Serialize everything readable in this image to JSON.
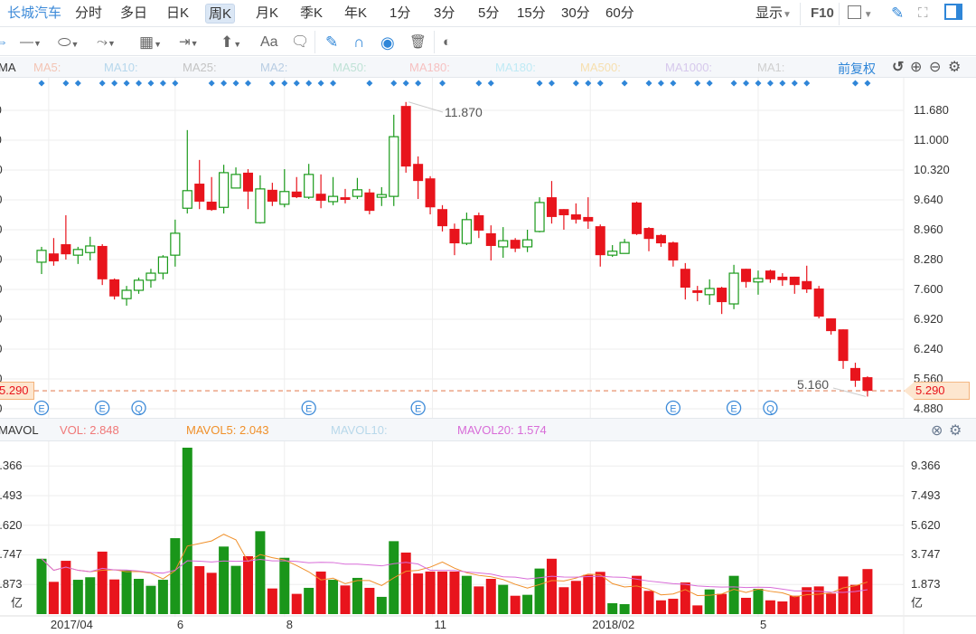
{
  "topbar": {
    "stock_name": "长城汽车",
    "periods": [
      "分时",
      "多日",
      "日K",
      "周K",
      "月K",
      "季K",
      "年K",
      "1分",
      "3分",
      "5分",
      "15分",
      "30分",
      "60分"
    ],
    "selected_period": "周K",
    "display_label": "显示",
    "f10_label": "F10"
  },
  "toolbar": {
    "tools": [
      {
        "name": "line-tool",
        "glyph": "—▾"
      },
      {
        "name": "shape-tool",
        "glyph": "⬭▾"
      },
      {
        "name": "wave-tool",
        "glyph": "⤳▾"
      },
      {
        "name": "grid-tool",
        "glyph": "▦▾"
      },
      {
        "name": "range-tool",
        "glyph": "⇥▾"
      },
      {
        "name": "arrow-tool",
        "glyph": "⬆▾"
      },
      {
        "name": "text-tool",
        "glyph": "Aa"
      },
      {
        "name": "comment-tool",
        "glyph": "▭"
      }
    ],
    "text_tool_label": "Aa"
  },
  "ma_legend": {
    "title": "MA",
    "items": [
      {
        "label": "MA5:",
        "color": "#f3c4b4"
      },
      {
        "label": "MA10:",
        "color": "#b6d7ec"
      },
      {
        "label": "MA25:",
        "color": "#c4c4c4"
      },
      {
        "label": "MA2:",
        "color": "#b8cde3"
      },
      {
        "label": "MA50:",
        "color": "#bfe2d6"
      },
      {
        "label": "MA180:",
        "color": "#f6c1c1"
      },
      {
        "label": "MA180:",
        "color": "#bfeaf5"
      },
      {
        "label": "MA500:",
        "color": "#f6dfae"
      },
      {
        "label": "MA1000:",
        "color": "#d6c8ec"
      },
      {
        "label": "MA1:",
        "color": "#cfcfcf"
      }
    ],
    "adjust_label": "前复权"
  },
  "vol_legend": {
    "title": "MAVOL",
    "vol": "VOL: 2.848",
    "mavol5": "MAVOL5: 2.043",
    "mavol10": "MAVOL10:",
    "mavol20": "MAVOL20: 1.574",
    "colors": {
      "vol": "#f07878",
      "mavol5": "#f0902a",
      "mavol10": "#b8d8ea",
      "mavol20": "#d86cd8"
    }
  },
  "colors": {
    "up": "#1a9a1a",
    "down": "#e8141c",
    "accent": "#2f86d8",
    "grid": "#eeeeee"
  },
  "chart_data": {
    "type": "candlestick",
    "price_ticks": [
      "11.680",
      "11.000",
      "10.320",
      "9.640",
      "8.960",
      "8.280",
      "7.600",
      "6.920",
      "6.240",
      "5.560",
      "4.880"
    ],
    "price_tick_values": [
      11.68,
      11.0,
      10.32,
      9.64,
      8.96,
      8.28,
      7.6,
      6.92,
      6.24,
      5.56,
      4.88
    ],
    "ylim": [
      4.88,
      11.68
    ],
    "volume_ticks": [
      "9.366",
      "7.493",
      "5.620",
      "3.747",
      "1.873"
    ],
    "volume_tick_values": [
      9.366,
      7.493,
      5.62,
      3.747,
      1.873
    ],
    "volume_unit": "亿",
    "x_labels": [
      {
        "label": "2017/04",
        "index": 2
      },
      {
        "label": "6",
        "index": 11
      },
      {
        "label": "8",
        "index": 20
      },
      {
        "label": "11",
        "index": 33
      },
      {
        "label": "2018/02",
        "index": 46
      },
      {
        "label": "5",
        "index": 59
      }
    ],
    "last_price": "5.290",
    "last_price_value": 5.29,
    "high_label": "11.870",
    "high_index": 30,
    "low_label": "5.160",
    "low_index": 68,
    "ohlc": [
      [
        8.22,
        8.57,
        7.95,
        8.49
      ],
      [
        8.42,
        8.77,
        8.14,
        8.24
      ],
      [
        8.63,
        9.29,
        8.28,
        8.4
      ],
      [
        8.38,
        8.57,
        8.18,
        8.51
      ],
      [
        8.44,
        8.8,
        8.26,
        8.59
      ],
      [
        8.59,
        8.63,
        7.7,
        7.83
      ],
      [
        7.83,
        7.85,
        7.37,
        7.44
      ],
      [
        7.39,
        7.68,
        7.23,
        7.58
      ],
      [
        7.58,
        7.87,
        7.5,
        7.81
      ],
      [
        7.81,
        8.07,
        7.64,
        7.97
      ],
      [
        7.97,
        8.38,
        7.83,
        8.34
      ],
      [
        8.38,
        9.19,
        8.12,
        8.88
      ],
      [
        9.45,
        11.23,
        9.33,
        9.85
      ],
      [
        10.01,
        10.55,
        9.43,
        9.6
      ],
      [
        9.6,
        10.16,
        9.39,
        9.41
      ],
      [
        9.47,
        10.44,
        9.33,
        10.26
      ],
      [
        9.91,
        10.38,
        9.91,
        10.22
      ],
      [
        10.26,
        10.34,
        9.43,
        9.83
      ],
      [
        9.12,
        10.2,
        9.1,
        9.89
      ],
      [
        9.87,
        10.03,
        9.5,
        9.6
      ],
      [
        9.54,
        10.34,
        9.47,
        9.83
      ],
      [
        9.83,
        10.16,
        9.68,
        9.7
      ],
      [
        9.7,
        10.46,
        9.66,
        10.22
      ],
      [
        9.78,
        10.22,
        9.45,
        9.62
      ],
      [
        9.6,
        10.16,
        9.52,
        9.72
      ],
      [
        9.7,
        9.89,
        9.56,
        9.64
      ],
      [
        9.72,
        10.14,
        9.66,
        9.87
      ],
      [
        9.81,
        9.89,
        9.31,
        9.39
      ],
      [
        9.7,
        9.93,
        9.5,
        9.76
      ],
      [
        9.72,
        11.58,
        9.5,
        11.08
      ],
      [
        11.78,
        11.87,
        10.26,
        10.4
      ],
      [
        10.46,
        10.63,
        9.66,
        10.07
      ],
      [
        10.13,
        10.18,
        9.31,
        9.47
      ],
      [
        9.43,
        9.52,
        8.92,
        9.04
      ],
      [
        8.98,
        9.1,
        8.38,
        8.65
      ],
      [
        8.65,
        9.35,
        8.61,
        9.19
      ],
      [
        9.29,
        9.35,
        8.77,
        8.94
      ],
      [
        8.88,
        9.06,
        8.26,
        8.59
      ],
      [
        8.57,
        9.02,
        8.32,
        8.71
      ],
      [
        8.73,
        8.77,
        8.45,
        8.53
      ],
      [
        8.57,
        8.96,
        8.45,
        8.73
      ],
      [
        8.92,
        9.7,
        8.9,
        9.58
      ],
      [
        9.7,
        10.07,
        9.1,
        9.25
      ],
      [
        9.43,
        9.43,
        8.96,
        9.29
      ],
      [
        9.31,
        9.56,
        9.1,
        9.19
      ],
      [
        9.25,
        9.7,
        8.98,
        9.15
      ],
      [
        9.04,
        9.08,
        8.12,
        8.38
      ],
      [
        8.38,
        8.61,
        8.34,
        8.47
      ],
      [
        8.42,
        8.75,
        8.42,
        8.67
      ],
      [
        9.58,
        9.6,
        8.84,
        8.86
      ],
      [
        9.0,
        9.02,
        8.47,
        8.75
      ],
      [
        8.84,
        8.86,
        8.57,
        8.65
      ],
      [
        8.67,
        8.69,
        8.12,
        8.26
      ],
      [
        8.07,
        8.2,
        7.37,
        7.64
      ],
      [
        7.58,
        7.68,
        7.33,
        7.52
      ],
      [
        7.48,
        7.83,
        7.25,
        7.62
      ],
      [
        7.64,
        7.66,
        7.04,
        7.31
      ],
      [
        7.27,
        8.16,
        7.15,
        7.97
      ],
      [
        8.07,
        8.07,
        7.64,
        7.77
      ],
      [
        7.77,
        8.03,
        7.48,
        7.85
      ],
      [
        8.03,
        8.05,
        7.75,
        7.83
      ],
      [
        7.89,
        7.97,
        7.68,
        7.81
      ],
      [
        7.89,
        7.89,
        7.5,
        7.7
      ],
      [
        7.79,
        8.14,
        7.52,
        7.6
      ],
      [
        7.62,
        7.68,
        6.94,
        6.98
      ],
      [
        6.94,
        6.94,
        6.57,
        6.65
      ],
      [
        6.69,
        6.69,
        5.79,
        5.97
      ],
      [
        5.81,
        5.93,
        5.38,
        5.52
      ],
      [
        5.6,
        5.62,
        5.16,
        5.29
      ]
    ],
    "volume": [
      3.5,
      2.04,
      3.37,
      2.17,
      2.33,
      3.95,
      2.19,
      2.76,
      2.23,
      1.79,
      2.17,
      4.8,
      10.52,
      3.03,
      2.61,
      4.27,
      3.05,
      3.66,
      5.24,
      1.62,
      3.56,
      1.28,
      1.66,
      2.69,
      2.17,
      1.81,
      2.29,
      1.66,
      1.09,
      4.61,
      3.89,
      2.57,
      2.69,
      2.69,
      2.69,
      2.42,
      1.75,
      2.23,
      1.85,
      1.16,
      1.22,
      2.88,
      3.5,
      1.7,
      2.1,
      2.48,
      2.67,
      0.69,
      0.63,
      2.42,
      1.47,
      0.87,
      0.97,
      2.0,
      0.55,
      1.56,
      1.28,
      2.42,
      1.03,
      1.6,
      0.87,
      0.8,
      1.16,
      1.7,
      1.75,
      1.3,
      2.38,
      1.85,
      2.848
    ],
    "signal_indices": [
      0,
      2,
      3,
      5,
      6,
      7,
      8,
      9,
      10,
      11,
      14,
      15,
      16,
      17,
      19,
      20,
      21,
      22,
      23,
      24,
      27,
      29,
      30,
      31,
      33,
      36,
      37,
      41,
      42,
      44,
      45,
      46,
      48,
      50,
      51,
      52,
      54,
      55,
      57,
      58,
      59,
      60,
      61,
      62,
      63,
      67,
      68
    ],
    "events": [
      {
        "index": 0,
        "label": "E"
      },
      {
        "index": 5,
        "label": "E"
      },
      {
        "index": 8,
        "label": "Q"
      },
      {
        "index": 22,
        "label": "E"
      },
      {
        "index": 31,
        "label": "E"
      },
      {
        "index": 52,
        "label": "E"
      },
      {
        "index": 57,
        "label": "E"
      },
      {
        "index": 60,
        "label": "Q"
      }
    ]
  }
}
